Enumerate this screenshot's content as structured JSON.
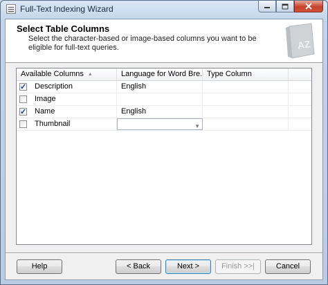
{
  "window": {
    "title": "Full-Text Indexing Wizard"
  },
  "caption_buttons": {
    "minimize_icon": "minimize-icon",
    "maximize_icon": "maximize-icon",
    "close_icon": "close-icon"
  },
  "header": {
    "title": "Select Table Columns",
    "description": "Select the character-based or image-based columns you want to be eligible for full-text queries."
  },
  "grid": {
    "columns": [
      "Available Columns",
      "Language for Word Bre...",
      "Type Column"
    ],
    "rows": [
      {
        "name": "Description",
        "checked": true,
        "language": "English",
        "type": ""
      },
      {
        "name": "Image",
        "checked": false,
        "language": "",
        "type": ""
      },
      {
        "name": "Name",
        "checked": true,
        "language": "English",
        "type": ""
      },
      {
        "name": "Thumbnail",
        "checked": false,
        "language": "",
        "type": ""
      }
    ]
  },
  "buttons": {
    "help": "Help",
    "back": "< Back",
    "next": "Next >",
    "finish": "Finish >>|",
    "cancel": "Cancel"
  }
}
